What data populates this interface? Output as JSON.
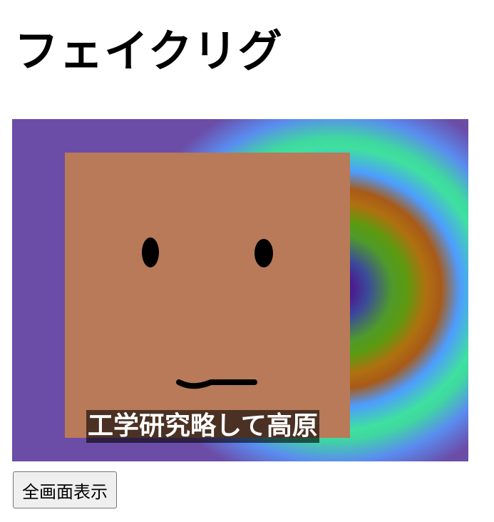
{
  "page": {
    "title": "フェイクリグ"
  },
  "video": {
    "subtitle": "工学研究略して高原"
  },
  "controls": {
    "fullscreen_label": "全画面表示"
  },
  "icons": {
    "face": "face-illustration"
  },
  "colors": {
    "face_skin": "#b87a58",
    "subtitle_background": "rgba(0,0,0,0.6)",
    "button_background": "#efefef"
  }
}
